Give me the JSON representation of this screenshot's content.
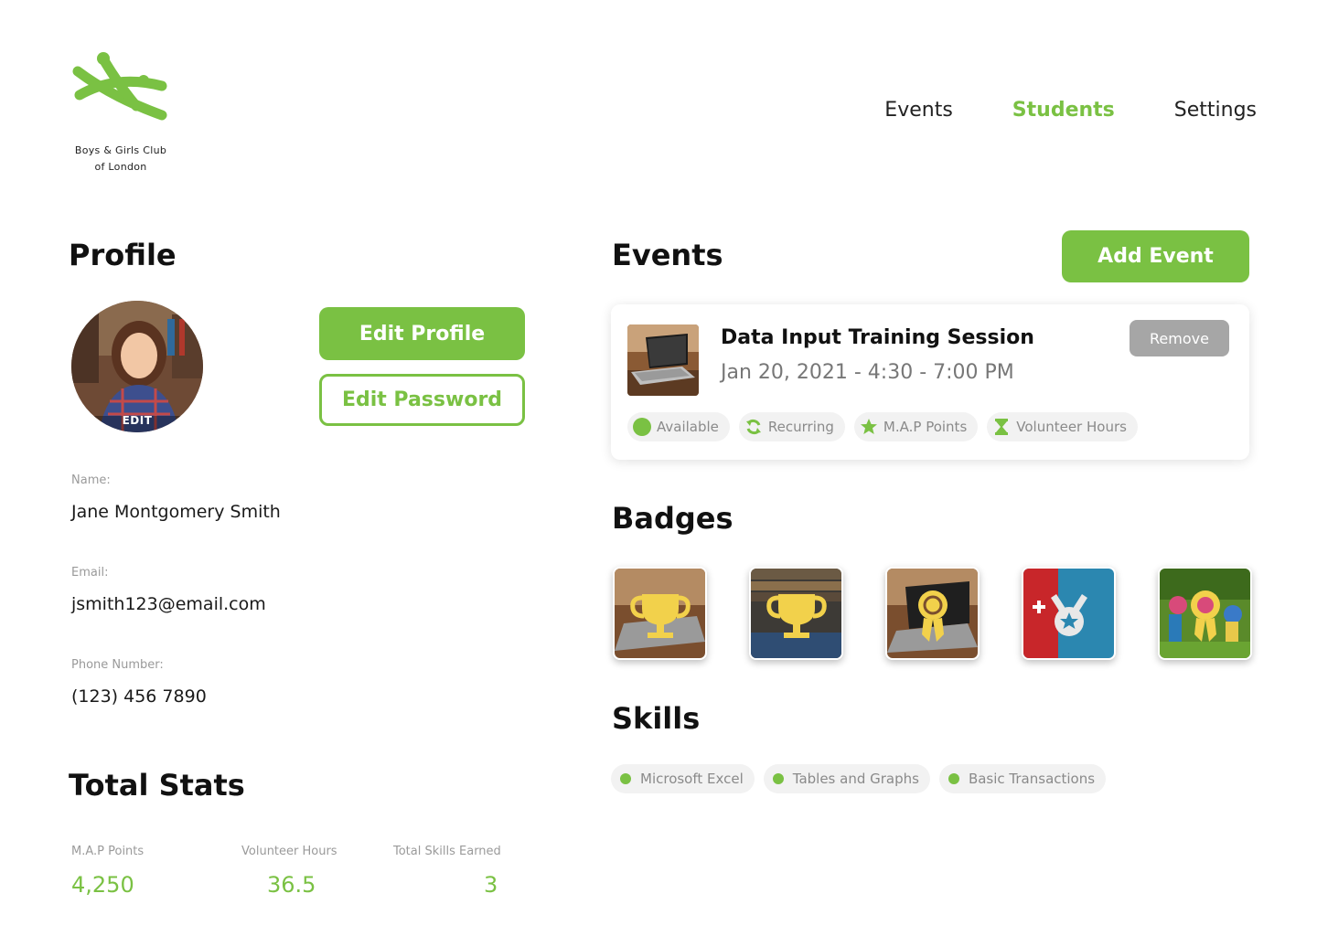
{
  "brand": {
    "name_line1": "Boys & Girls Club",
    "name_line2": "of London",
    "color": "#7ac143",
    "icon": "club-logo-icon"
  },
  "nav": {
    "items": [
      {
        "label": "Events",
        "active": false
      },
      {
        "label": "Students",
        "active": true
      },
      {
        "label": "Settings",
        "active": false
      }
    ]
  },
  "profile": {
    "heading": "Profile",
    "avatar_edit_label": "EDIT",
    "edit_profile_label": "Edit Profile",
    "edit_password_label": "Edit Password",
    "name_label": "Name:",
    "name_value": "Jane Montgomery Smith",
    "email_label": "Email:",
    "email_value": "jsmith123@email.com",
    "phone_label": "Phone Number:",
    "phone_value": "(123) 456 7890"
  },
  "stats": {
    "heading": "Total Stats",
    "items": [
      {
        "label": "M.A.P Points",
        "value": "4,250"
      },
      {
        "label": "Volunteer Hours",
        "value": "36.5"
      },
      {
        "label": "Total Skills Earned",
        "value": "3"
      }
    ]
  },
  "events": {
    "heading": "Events",
    "add_label": "Add Event",
    "items": [
      {
        "title": "Data Input Training Session",
        "date": "Jan 20, 2021 - 4:30 - 7:00 PM",
        "remove_label": "Remove",
        "tags": [
          {
            "label": "Available",
            "icon": "available-dot-icon"
          },
          {
            "label": "Recurring",
            "icon": "recurring-icon"
          },
          {
            "label": "M.A.P Points",
            "icon": "star-icon"
          },
          {
            "label": "Volunteer Hours",
            "icon": "hourglass-icon"
          }
        ]
      }
    ]
  },
  "badges": {
    "heading": "Badges",
    "items": [
      {
        "icon": "trophy-icon"
      },
      {
        "icon": "trophy-icon"
      },
      {
        "icon": "ribbon-icon"
      },
      {
        "icon": "medal-icon"
      },
      {
        "icon": "ribbon-icon"
      }
    ]
  },
  "skills": {
    "heading": "Skills",
    "items": [
      "Microsoft Excel",
      "Tables and Graphs",
      "Basic Transactions"
    ]
  }
}
